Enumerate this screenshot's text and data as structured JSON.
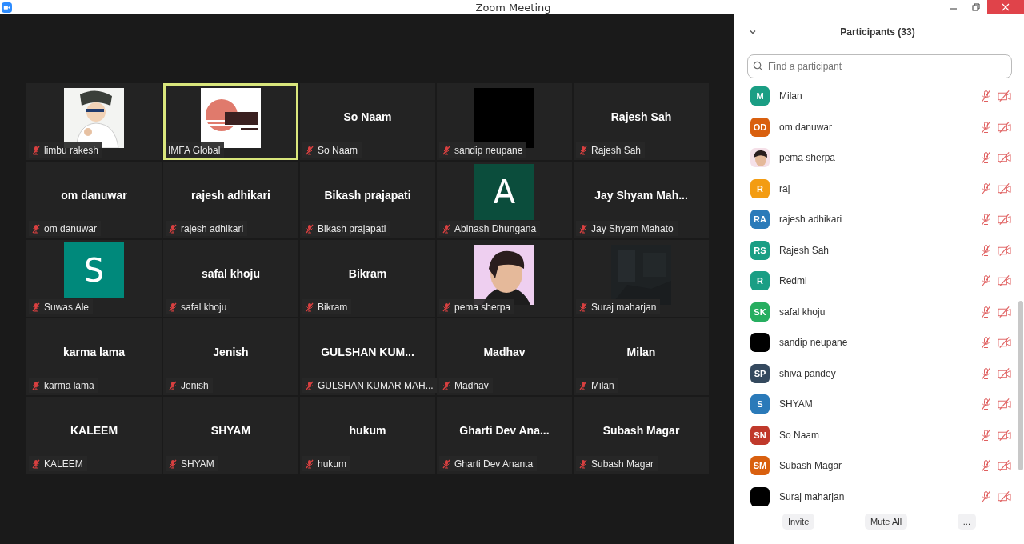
{
  "window": {
    "title": "Zoom Meeting"
  },
  "gallery": {
    "tiles": [
      {
        "kind": "picture",
        "name_tag": "limbu rakesh",
        "muted": true,
        "active_speaker": false
      },
      {
        "kind": "picture",
        "name_tag": "IMFA Global",
        "muted": false,
        "active_speaker": true
      },
      {
        "kind": "name",
        "display_name": "So Naam",
        "name_tag": "So Naam",
        "muted": true,
        "active_speaker": false
      },
      {
        "kind": "blank",
        "name_tag": "sandip neupane",
        "muted": true,
        "active_speaker": false
      },
      {
        "kind": "name",
        "display_name": "Rajesh Sah",
        "name_tag": "Rajesh Sah",
        "muted": true,
        "active_speaker": false
      },
      {
        "kind": "name",
        "display_name": "om danuwar",
        "name_tag": "om danuwar",
        "muted": true,
        "active_speaker": false
      },
      {
        "kind": "name",
        "display_name": "rajesh adhikari",
        "name_tag": "rajesh adhikari",
        "muted": true,
        "active_speaker": false
      },
      {
        "kind": "name",
        "display_name": "Bikash prajapati",
        "name_tag": "Bikash prajapati",
        "muted": true,
        "active_speaker": false
      },
      {
        "kind": "letter",
        "letter": "A",
        "color": "#0b4d3c",
        "name_tag": "Abinash Dhungana",
        "muted": true,
        "active_speaker": false
      },
      {
        "kind": "name",
        "display_name": "Jay Shyam Mah...",
        "name_tag": "Jay Shyam Mahato",
        "muted": true,
        "active_speaker": false
      },
      {
        "kind": "letter",
        "letter": "S",
        "color": "#00897b",
        "name_tag": "Suwas Ale",
        "muted": true,
        "active_speaker": false
      },
      {
        "kind": "name",
        "display_name": "safal khoju",
        "name_tag": "safal khoju",
        "muted": true,
        "active_speaker": false
      },
      {
        "kind": "name",
        "display_name": "Bikram",
        "name_tag": "Bikram",
        "muted": true,
        "active_speaker": false
      },
      {
        "kind": "picture",
        "name_tag": "pema sherpa",
        "muted": true,
        "active_speaker": false
      },
      {
        "kind": "picture",
        "name_tag": "Suraj maharjan",
        "muted": true,
        "active_speaker": false
      },
      {
        "kind": "name",
        "display_name": "karma lama",
        "name_tag": "karma lama",
        "muted": true,
        "active_speaker": false
      },
      {
        "kind": "name",
        "display_name": "Jenish",
        "name_tag": "Jenish",
        "muted": true,
        "active_speaker": false
      },
      {
        "kind": "name",
        "display_name": "GULSHAN KUM...",
        "name_tag": "GULSHAN KUMAR MAH...",
        "muted": true,
        "active_speaker": false
      },
      {
        "kind": "name",
        "display_name": "Madhav",
        "name_tag": "Madhav",
        "muted": true,
        "active_speaker": false
      },
      {
        "kind": "name",
        "display_name": "Milan",
        "name_tag": "Milan",
        "muted": true,
        "active_speaker": false
      },
      {
        "kind": "name",
        "display_name": "KALEEM",
        "name_tag": "KALEEM",
        "muted": true,
        "active_speaker": false
      },
      {
        "kind": "name",
        "display_name": "SHYAM",
        "name_tag": "SHYAM",
        "muted": true,
        "active_speaker": false
      },
      {
        "kind": "name",
        "display_name": "hukum",
        "name_tag": "hukum",
        "muted": true,
        "active_speaker": false
      },
      {
        "kind": "name",
        "display_name": "Gharti Dev Ana...",
        "name_tag": "Gharti Dev Ananta",
        "muted": true,
        "active_speaker": false
      },
      {
        "kind": "name",
        "display_name": "Subash Magar",
        "name_tag": "Subash Magar",
        "muted": true,
        "active_speaker": false
      }
    ]
  },
  "participants_panel": {
    "title": "Participants (33)",
    "search": {
      "placeholder": "Find a participant"
    },
    "participants": [
      {
        "kind": "initials",
        "initials": "M",
        "color": "#1a9e84",
        "name": "Milan",
        "muted": true,
        "video_off": true
      },
      {
        "kind": "initials",
        "initials": "OD",
        "color": "#d9600f",
        "name": "om danuwar",
        "muted": true,
        "video_off": true
      },
      {
        "kind": "picture",
        "name": "pema sherpa",
        "muted": true,
        "video_off": true
      },
      {
        "kind": "initials",
        "initials": "R",
        "color": "#f39c12",
        "name": "raj",
        "muted": true,
        "video_off": true
      },
      {
        "kind": "initials",
        "initials": "RA",
        "color": "#2a7ab9",
        "name": "rajesh adhikari",
        "muted": true,
        "video_off": true
      },
      {
        "kind": "initials",
        "initials": "RS",
        "color": "#1a9e84",
        "name": "Rajesh Sah",
        "muted": true,
        "video_off": true
      },
      {
        "kind": "initials",
        "initials": "R",
        "color": "#1a9e84",
        "name": "Redmi",
        "muted": true,
        "video_off": true
      },
      {
        "kind": "initials",
        "initials": "SK",
        "color": "#27ae60",
        "name": "safal khoju",
        "muted": true,
        "video_off": true
      },
      {
        "kind": "blank",
        "name": "sandip neupane",
        "muted": true,
        "video_off": true
      },
      {
        "kind": "initials",
        "initials": "SP",
        "color": "#34495e",
        "name": "shiva pandey",
        "muted": true,
        "video_off": true
      },
      {
        "kind": "initials",
        "initials": "S",
        "color": "#2a7ab9",
        "name": "SHYAM",
        "muted": true,
        "video_off": true
      },
      {
        "kind": "initials",
        "initials": "SN",
        "color": "#c0392b",
        "name": "So Naam",
        "muted": true,
        "video_off": true
      },
      {
        "kind": "initials",
        "initials": "SM",
        "color": "#d9600f",
        "name": "Subash Magar",
        "muted": true,
        "video_off": true
      },
      {
        "kind": "blank",
        "name": "Suraj maharjan",
        "muted": true,
        "video_off": true
      }
    ],
    "buttons": [
      "Invite",
      "Mute All",
      "..."
    ]
  }
}
